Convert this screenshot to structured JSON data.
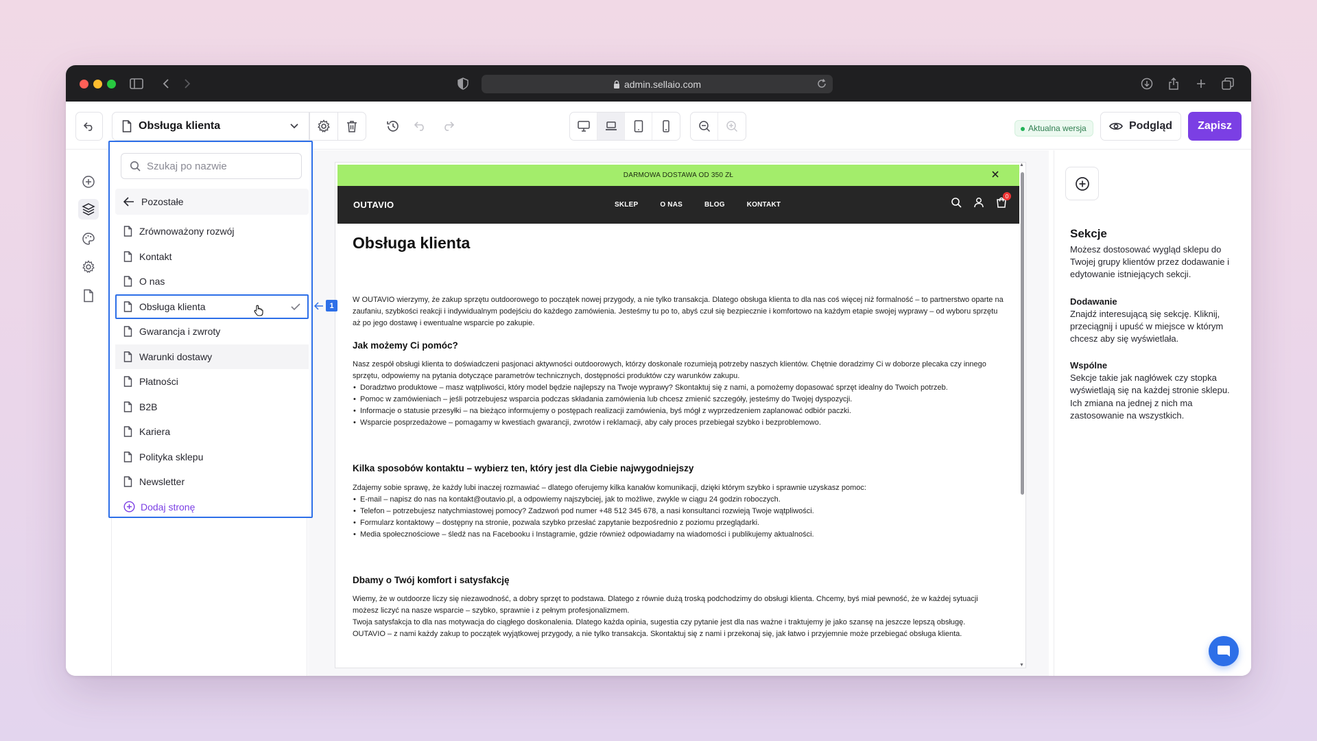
{
  "browser": {
    "url": "admin.sellaio.com"
  },
  "toolbar": {
    "page_select_label": "Obsługa klienta",
    "version_badge": "Aktualna wersja",
    "preview_label": "Podgląd",
    "save_label": "Zapisz",
    "colors": {
      "accent": "#7b3fe4",
      "selection": "#2d6fe8"
    }
  },
  "page_dropdown": {
    "search_placeholder": "Szukaj po nazwie",
    "back_label": "Pozostałe",
    "items": [
      {
        "label": "Zrównoważony rozwój"
      },
      {
        "label": "Kontakt"
      },
      {
        "label": "O nas"
      },
      {
        "label": "Obsługa klienta"
      },
      {
        "label": "Gwarancja i zwroty"
      },
      {
        "label": "Warunki dostawy"
      },
      {
        "label": "Płatności"
      },
      {
        "label": "B2B"
      },
      {
        "label": "Kariera"
      },
      {
        "label": "Polityka sklepu"
      },
      {
        "label": "Newsletter"
      }
    ],
    "selected_index": 3,
    "add_page_label": "Dodaj stronę",
    "annotation_number": "1"
  },
  "preview": {
    "promo_text": "DARMOWA DOSTAWA OD 350 ZŁ",
    "logo": "OUTAVIO",
    "menu": [
      "SKLEP",
      "O NAS",
      "BLOG",
      "KONTAKT"
    ],
    "cart_count": "0",
    "title": "Obsługa klienta",
    "intro": "W OUTAVIO wierzymy, że zakup sprzętu outdoorowego to początek nowej przygody, a nie tylko transakcja. Dlatego obsługa klienta to dla nas coś więcej niż formalność – to partnerstwo oparte na zaufaniu, szybkości reakcji i indywidualnym podejściu do każdego zamówienia. Jesteśmy tu po to, abyś czuł się bezpiecznie i komfortowo na każdym etapie swojej wyprawy – od wyboru sprzętu aż po jego dostawę i ewentualne wsparcie po zakupie.",
    "section1": {
      "heading": "Jak możemy Ci pomóc?",
      "text": "Nasz zespół obsługi klienta to doświadczeni pasjonaci aktywności outdoorowych, którzy doskonale rozumieją potrzeby naszych klientów. Chętnie doradzimy Ci w doborze plecaka czy innego sprzętu, odpowiemy na pytania dotyczące parametrów technicznych, dostępności produktów czy warunków zakupu.",
      "bullets": [
        "Doradztwo produktowe – masz wątpliwości, który model będzie najlepszy na Twoje wyprawy? Skontaktuj się z nami, a pomożemy dopasować sprzęt idealny do Twoich potrzeb.",
        "Pomoc w zamówieniach – jeśli potrzebujesz wsparcia podczas składania zamówienia lub chcesz zmienić szczegóły, jesteśmy do Twojej dyspozycji.",
        "Informacje o statusie przesyłki – na bieżąco informujemy o postępach realizacji zamówienia, byś mógł z wyprzedzeniem zaplanować odbiór paczki.",
        "Wsparcie posprzedażowe – pomagamy w kwestiach gwarancji, zwrotów i reklamacji, aby cały proces przebiegał szybko i bezproblemowo."
      ]
    },
    "section2": {
      "heading": "Kilka sposobów kontaktu – wybierz ten, który jest dla Ciebie najwygodniejszy",
      "text": "Zdajemy sobie sprawę, że każdy lubi inaczej rozmawiać – dlatego oferujemy kilka kanałów komunikacji, dzięki którym szybko i sprawnie uzyskasz pomoc:",
      "bullets": [
        "E-mail – napisz do nas na kontakt@outavio.pl, a odpowiemy najszybciej, jak to możliwe, zwykle w ciągu 24 godzin roboczych.",
        "Telefon – potrzebujesz natychmiastowej pomocy? Zadzwoń pod numer +48 512 345 678, a nasi konsultanci rozwieją Twoje wątpliwości.",
        "Formularz kontaktowy – dostępny na stronie, pozwala szybko przesłać zapytanie bezpośrednio z poziomu przeglądarki.",
        "Media społecznościowe – śledź nas na Facebooku i Instagramie, gdzie również odpowiadamy na wiadomości i publikujemy aktualności."
      ]
    },
    "section3": {
      "heading": "Dbamy o Twój komfort i satysfakcję",
      "p1": "Wiemy, że w outdoorze liczy się niezawodność, a dobry sprzęt to podstawa. Dlatego z równie dużą troską podchodzimy do obsługi klienta. Chcemy, byś miał pewność, że w każdej sytuacji możesz liczyć na nasze wsparcie – szybko, sprawnie i z pełnym profesjonalizmem.",
      "p2": "Twoja satysfakcja to dla nas motywacja do ciągłego doskonalenia. Dlatego każda opinia, sugestia czy pytanie jest dla nas ważne i traktujemy je jako szansę na jeszcze lepszą obsługę.",
      "p3": "OUTAVIO – z nami każdy zakup to początek wyjątkowej przygody, a nie tylko transakcja. Skontaktuj się z nami i przekonaj się, jak łatwo i przyjemnie może przebiegać obsługa klienta."
    }
  },
  "right_panel": {
    "title": "Sekcje",
    "intro": "Możesz dostosować wygląd sklepu do Twojej grupy klientów przez dodawanie i edytowanie istniejących sekcji.",
    "add_heading": "Dodawanie",
    "add_text": "Znajdź interesującą się sekcję. Kliknij, przeciągnij i upuść w miejsce w którym chcesz aby się wyświetlała.",
    "common_heading": "Wspólne",
    "common_text": "Sekcje takie jak nagłówek czy stopka wyświetlają się na każdej stronie sklepu. Ich zmiana na jednej z nich ma zastosowanie na wszystkich."
  }
}
